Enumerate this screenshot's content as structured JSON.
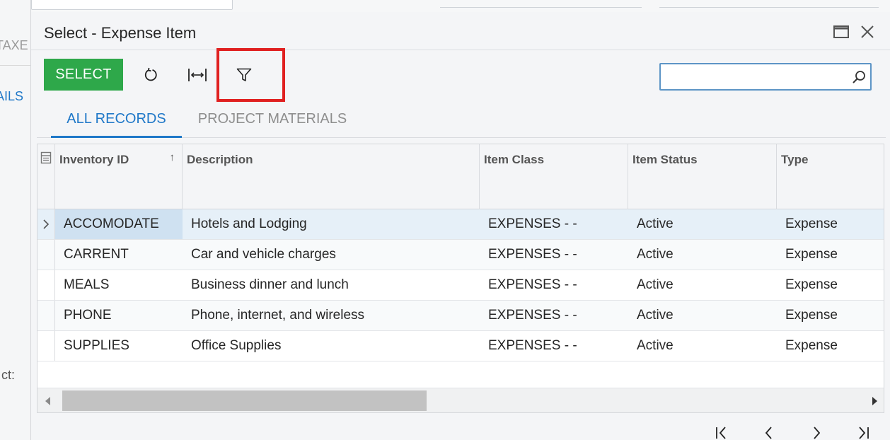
{
  "background": {
    "left_labels": [
      "TAXE",
      "AILS",
      "ct:"
    ]
  },
  "dialog": {
    "title": "Select - Expense Item"
  },
  "toolbar": {
    "select_label": "SELECT"
  },
  "search": {
    "value": "",
    "placeholder": ""
  },
  "tabs": [
    {
      "label": "ALL RECORDS",
      "active": true
    },
    {
      "label": "PROJECT MATERIALS",
      "active": false
    }
  ],
  "grid": {
    "columns": [
      "Inventory ID",
      "Description",
      "Item Class",
      "Item Status",
      "Type"
    ],
    "sort_column": "Inventory ID",
    "rows": [
      {
        "inventory_id": "ACCOMODATE",
        "description": "Hotels and Lodging",
        "item_class": "EXPENSES - -",
        "item_status": "Active",
        "type": "Expense"
      },
      {
        "inventory_id": "CARRENT",
        "description": "Car and vehicle charges",
        "item_class": "EXPENSES - -",
        "item_status": "Active",
        "type": "Expense"
      },
      {
        "inventory_id": "MEALS",
        "description": "Business dinner and lunch",
        "item_class": "EXPENSES - -",
        "item_status": "Active",
        "type": "Expense"
      },
      {
        "inventory_id": "PHONE",
        "description": "Phone, internet, and wireless",
        "item_class": "EXPENSES - -",
        "item_status": "Active",
        "type": "Expense"
      },
      {
        "inventory_id": "SUPPLIES",
        "description": "Office Supplies",
        "item_class": "EXPENSES - -",
        "item_status": "Active",
        "type": "Expense"
      }
    ],
    "selected_row": 0
  },
  "colors": {
    "accent": "#1f78c8",
    "select_button": "#2ea84a",
    "highlight": "#e02020",
    "selected_row": "#e6f0f8"
  },
  "icons": {
    "refresh": "refresh-icon",
    "fit_columns": "fit-columns-icon",
    "filter": "filter-icon",
    "search": "search-icon",
    "maximize": "maximize-icon",
    "close": "close-icon"
  }
}
